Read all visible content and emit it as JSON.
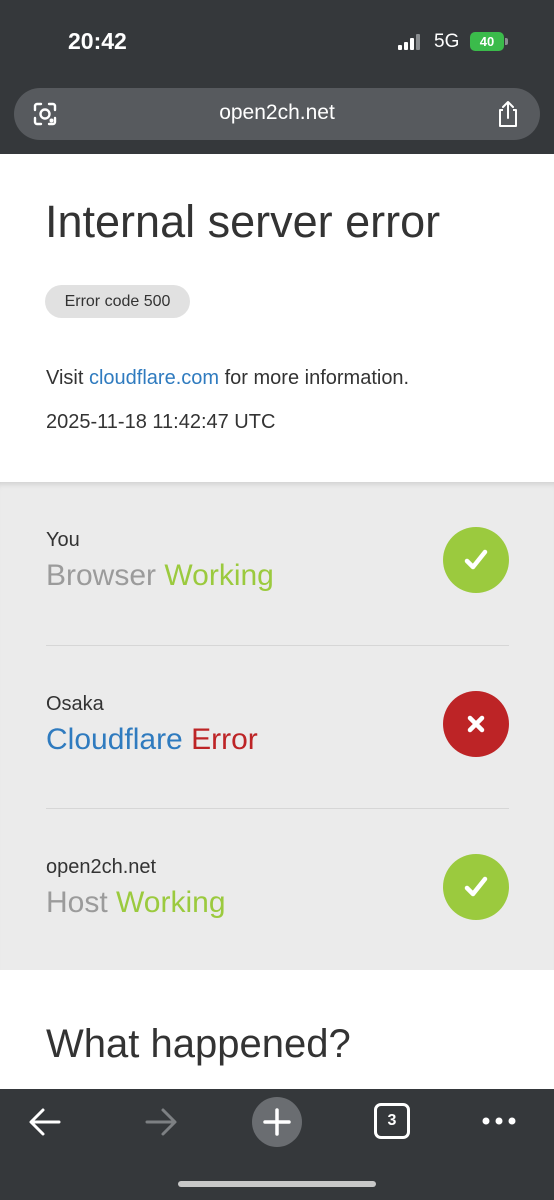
{
  "status_bar": {
    "time": "20:42",
    "network": "5G",
    "battery": "40"
  },
  "browser": {
    "url": "open2ch.net",
    "tab_count": "3",
    "icons": [
      "lens-icon",
      "share-icon",
      "back-arrow-icon",
      "forward-arrow-icon",
      "new-tab-icon",
      "tab-switcher-icon",
      "more-icon"
    ]
  },
  "page": {
    "title": "Internal server error",
    "error_badge": "Error code 500",
    "visit_prefix": "Visit ",
    "visit_link": "cloudflare.com",
    "visit_suffix": " for more information.",
    "timestamp": "2025-11-18 11:42:47 UTC",
    "status_rows": [
      {
        "location": "You",
        "name": "Browser",
        "status": "Working",
        "state": "ok"
      },
      {
        "location": "Osaka",
        "name": "Cloudflare",
        "status": "Error",
        "state": "error"
      },
      {
        "location": "open2ch.net",
        "name": "Host",
        "status": "Working",
        "state": "ok"
      }
    ],
    "what_happened": "What happened?"
  },
  "colors": {
    "chrome_bg": "#35383b",
    "ok_green": "#9bca3e",
    "error_red": "#bd2426",
    "link_blue": "#2f7bbf",
    "battery_green": "#3bbb4b"
  }
}
